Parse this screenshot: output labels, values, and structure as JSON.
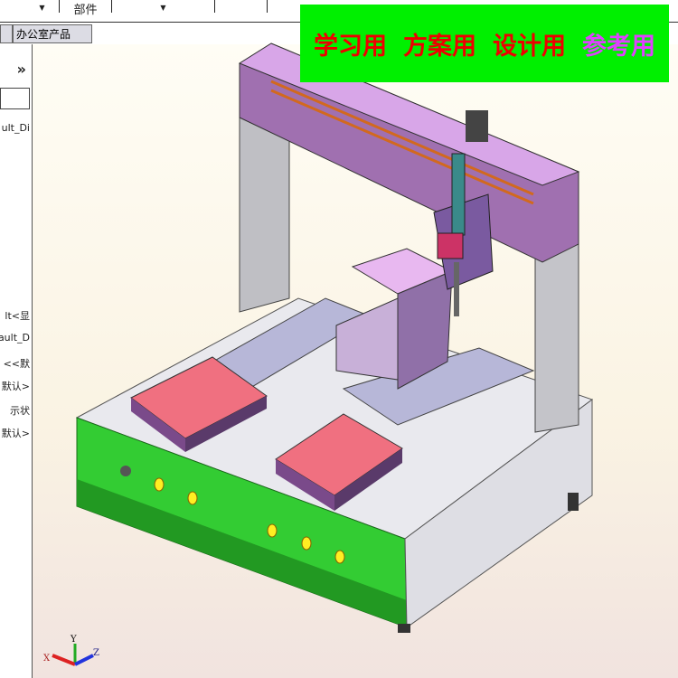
{
  "toolbar": {
    "parts_label": "部件",
    "dropdown_arrow": "▼"
  },
  "tabs": [
    {
      "label": "办公室产品"
    }
  ],
  "left_panel": {
    "expand_label": "»",
    "tree_items": [
      "ult_Di",
      "lt<显",
      "ault_D",
      "<<默",
      "默认>",
      "示状",
      "默认>"
    ]
  },
  "banner": {
    "items": [
      "学习用",
      "方案用",
      "设计用",
      "参考用"
    ],
    "colors": {
      "bg": "#00f000",
      "text": "#ee0000",
      "ref": "#e040ff"
    }
  },
  "triad": {
    "x": "X",
    "y": "Y",
    "z": "Z"
  }
}
